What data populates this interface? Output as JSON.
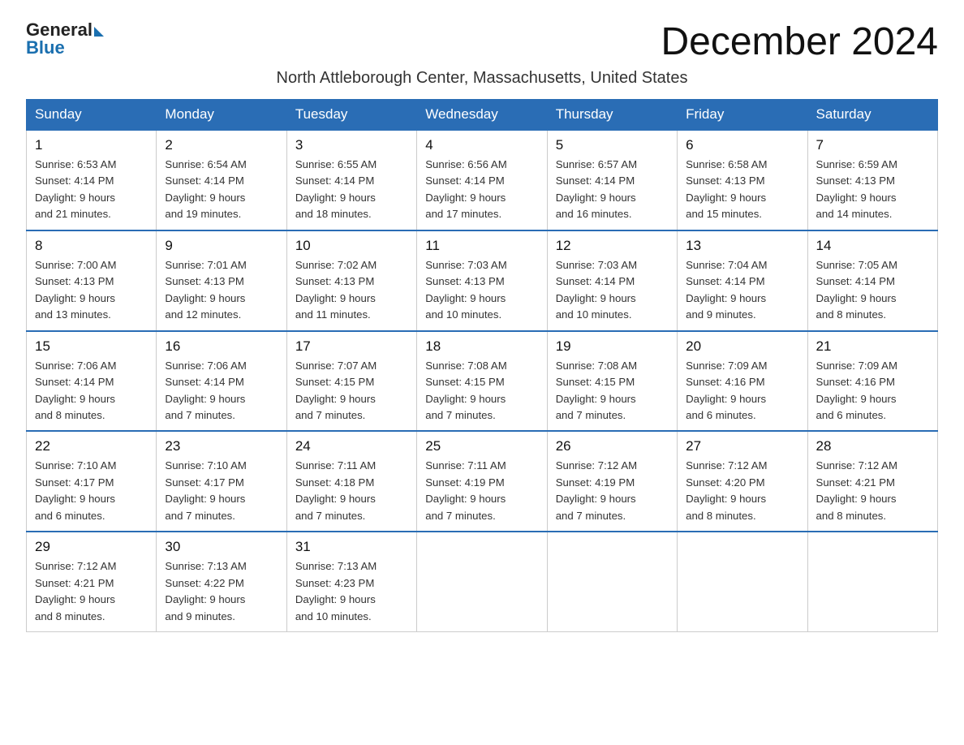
{
  "header": {
    "logo_general": "General",
    "logo_blue": "Blue",
    "title": "December 2024",
    "subtitle": "North Attleborough Center, Massachusetts, United States"
  },
  "weekdays": [
    "Sunday",
    "Monday",
    "Tuesday",
    "Wednesday",
    "Thursday",
    "Friday",
    "Saturday"
  ],
  "weeks": [
    [
      {
        "day": "1",
        "sunrise": "6:53 AM",
        "sunset": "4:14 PM",
        "daylight": "9 hours and 21 minutes."
      },
      {
        "day": "2",
        "sunrise": "6:54 AM",
        "sunset": "4:14 PM",
        "daylight": "9 hours and 19 minutes."
      },
      {
        "day": "3",
        "sunrise": "6:55 AM",
        "sunset": "4:14 PM",
        "daylight": "9 hours and 18 minutes."
      },
      {
        "day": "4",
        "sunrise": "6:56 AM",
        "sunset": "4:14 PM",
        "daylight": "9 hours and 17 minutes."
      },
      {
        "day": "5",
        "sunrise": "6:57 AM",
        "sunset": "4:14 PM",
        "daylight": "9 hours and 16 minutes."
      },
      {
        "day": "6",
        "sunrise": "6:58 AM",
        "sunset": "4:13 PM",
        "daylight": "9 hours and 15 minutes."
      },
      {
        "day": "7",
        "sunrise": "6:59 AM",
        "sunset": "4:13 PM",
        "daylight": "9 hours and 14 minutes."
      }
    ],
    [
      {
        "day": "8",
        "sunrise": "7:00 AM",
        "sunset": "4:13 PM",
        "daylight": "9 hours and 13 minutes."
      },
      {
        "day": "9",
        "sunrise": "7:01 AM",
        "sunset": "4:13 PM",
        "daylight": "9 hours and 12 minutes."
      },
      {
        "day": "10",
        "sunrise": "7:02 AM",
        "sunset": "4:13 PM",
        "daylight": "9 hours and 11 minutes."
      },
      {
        "day": "11",
        "sunrise": "7:03 AM",
        "sunset": "4:13 PM",
        "daylight": "9 hours and 10 minutes."
      },
      {
        "day": "12",
        "sunrise": "7:03 AM",
        "sunset": "4:14 PM",
        "daylight": "9 hours and 10 minutes."
      },
      {
        "day": "13",
        "sunrise": "7:04 AM",
        "sunset": "4:14 PM",
        "daylight": "9 hours and 9 minutes."
      },
      {
        "day": "14",
        "sunrise": "7:05 AM",
        "sunset": "4:14 PM",
        "daylight": "9 hours and 8 minutes."
      }
    ],
    [
      {
        "day": "15",
        "sunrise": "7:06 AM",
        "sunset": "4:14 PM",
        "daylight": "9 hours and 8 minutes."
      },
      {
        "day": "16",
        "sunrise": "7:06 AM",
        "sunset": "4:14 PM",
        "daylight": "9 hours and 7 minutes."
      },
      {
        "day": "17",
        "sunrise": "7:07 AM",
        "sunset": "4:15 PM",
        "daylight": "9 hours and 7 minutes."
      },
      {
        "day": "18",
        "sunrise": "7:08 AM",
        "sunset": "4:15 PM",
        "daylight": "9 hours and 7 minutes."
      },
      {
        "day": "19",
        "sunrise": "7:08 AM",
        "sunset": "4:15 PM",
        "daylight": "9 hours and 7 minutes."
      },
      {
        "day": "20",
        "sunrise": "7:09 AM",
        "sunset": "4:16 PM",
        "daylight": "9 hours and 6 minutes."
      },
      {
        "day": "21",
        "sunrise": "7:09 AM",
        "sunset": "4:16 PM",
        "daylight": "9 hours and 6 minutes."
      }
    ],
    [
      {
        "day": "22",
        "sunrise": "7:10 AM",
        "sunset": "4:17 PM",
        "daylight": "9 hours and 6 minutes."
      },
      {
        "day": "23",
        "sunrise": "7:10 AM",
        "sunset": "4:17 PM",
        "daylight": "9 hours and 7 minutes."
      },
      {
        "day": "24",
        "sunrise": "7:11 AM",
        "sunset": "4:18 PM",
        "daylight": "9 hours and 7 minutes."
      },
      {
        "day": "25",
        "sunrise": "7:11 AM",
        "sunset": "4:19 PM",
        "daylight": "9 hours and 7 minutes."
      },
      {
        "day": "26",
        "sunrise": "7:12 AM",
        "sunset": "4:19 PM",
        "daylight": "9 hours and 7 minutes."
      },
      {
        "day": "27",
        "sunrise": "7:12 AM",
        "sunset": "4:20 PM",
        "daylight": "9 hours and 8 minutes."
      },
      {
        "day": "28",
        "sunrise": "7:12 AM",
        "sunset": "4:21 PM",
        "daylight": "9 hours and 8 minutes."
      }
    ],
    [
      {
        "day": "29",
        "sunrise": "7:12 AM",
        "sunset": "4:21 PM",
        "daylight": "9 hours and 8 minutes."
      },
      {
        "day": "30",
        "sunrise": "7:13 AM",
        "sunset": "4:22 PM",
        "daylight": "9 hours and 9 minutes."
      },
      {
        "day": "31",
        "sunrise": "7:13 AM",
        "sunset": "4:23 PM",
        "daylight": "9 hours and 10 minutes."
      },
      null,
      null,
      null,
      null
    ]
  ],
  "labels": {
    "sunrise": "Sunrise:",
    "sunset": "Sunset:",
    "daylight": "Daylight:"
  }
}
